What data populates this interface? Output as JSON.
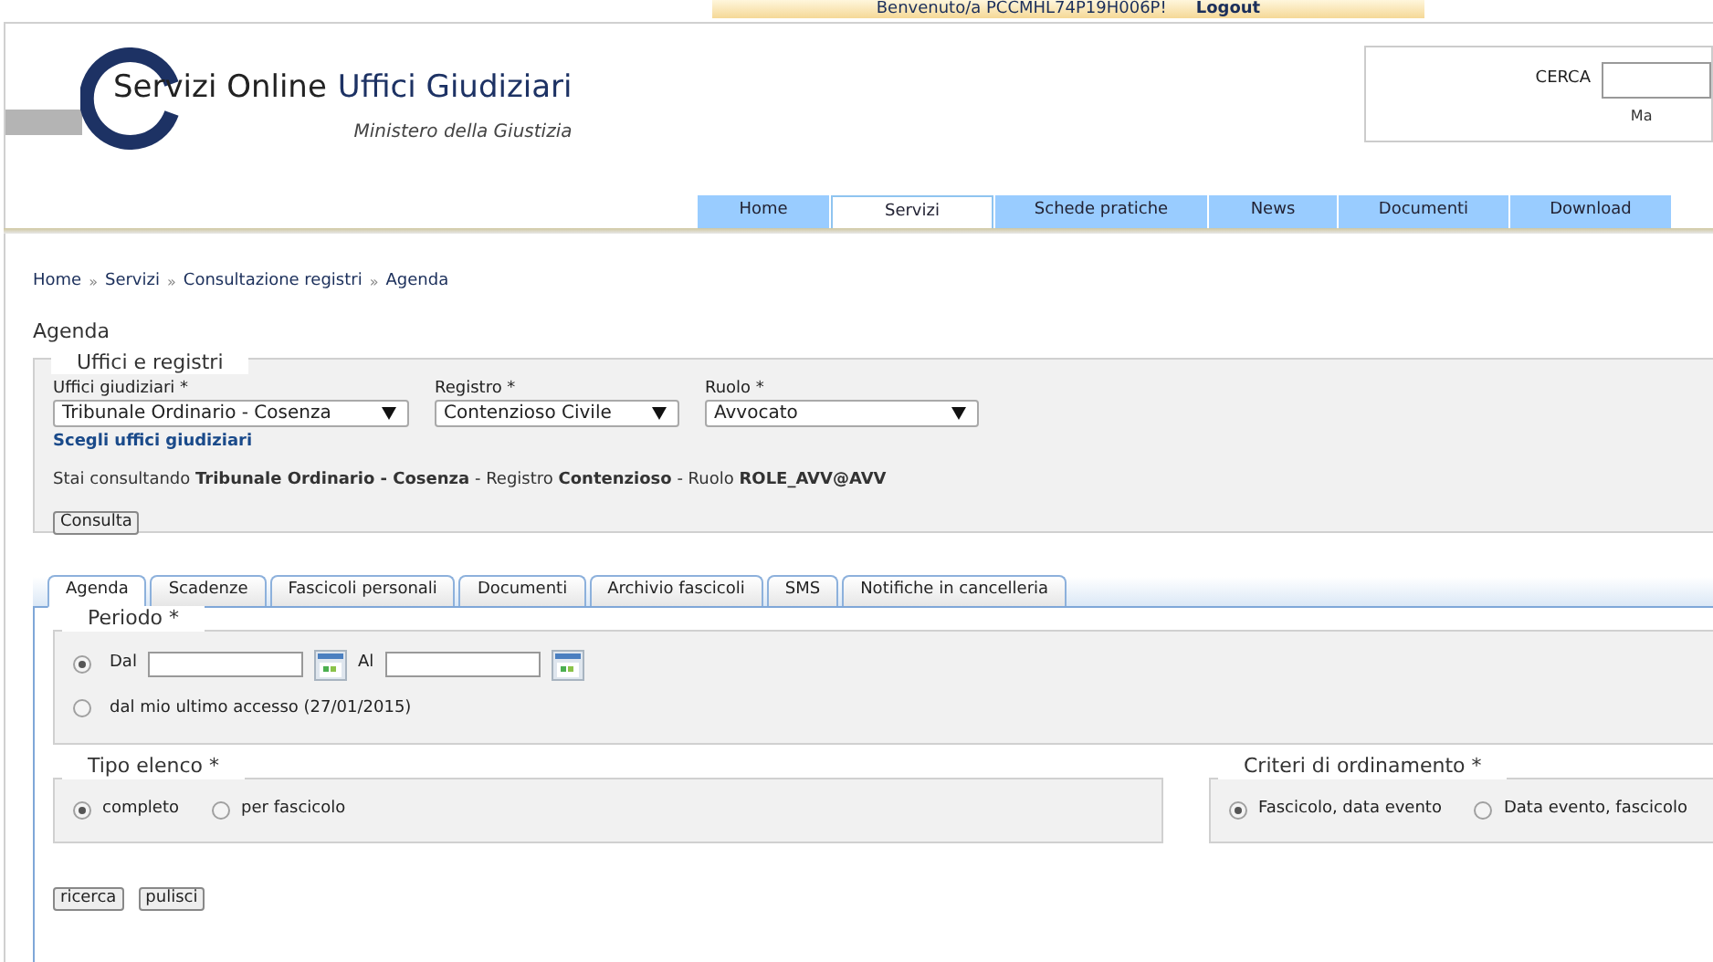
{
  "top_bar": {
    "welcome": "Benvenuto/a PCCMHL74P19H006P!",
    "logout": "Logout"
  },
  "logo": {
    "title_part1": "Servizi Online",
    "title_part2": "Uffici Giudiziari",
    "subtitle": "Ministero della Giustizia"
  },
  "search": {
    "label": "CERCA",
    "link": "Ma"
  },
  "nav_tabs": [
    {
      "label": "Home",
      "selected": false
    },
    {
      "label": "Servizi",
      "selected": true
    },
    {
      "label": "Schede pratiche",
      "selected": false
    },
    {
      "label": "News",
      "selected": false
    },
    {
      "label": "Documenti",
      "selected": false
    },
    {
      "label": "Download",
      "selected": false
    }
  ],
  "breadcrumb": [
    {
      "label": "Home"
    },
    {
      "separator": "»",
      "label": "Servizi"
    },
    {
      "separator": "»",
      "label": "Consultazione registri"
    },
    {
      "separator": "»",
      "label": "Agenda"
    }
  ],
  "page_title": "Agenda",
  "offices": {
    "legend": "Uffici e registri",
    "fields": [
      {
        "label": "Uffici giudiziari *",
        "value": "Tribunale Ordinario - Cosenza"
      },
      {
        "label": "Registro *",
        "value": "Contenzioso Civile"
      },
      {
        "label": "Ruolo *",
        "value": "Avvocato"
      }
    ],
    "link": "Scegli uffici giudiziari",
    "status": "Stai consultando **Tribunale Ordinario - Cosenza** - Registro **Contenzioso** - Ruolo **ROLE_AVV@AVV**",
    "button": "Consulta"
  },
  "tabs": [
    {
      "label": "Agenda",
      "selected": true
    },
    {
      "label": "Scadenze",
      "selected": false
    },
    {
      "label": "Fascicoli personali",
      "selected": false
    },
    {
      "label": "Documenti",
      "selected": false
    },
    {
      "label": "Archivio fascicoli",
      "selected": false
    },
    {
      "label": "SMS",
      "selected": false
    },
    {
      "label": "Notifiche in cancelleria",
      "selected": false
    }
  ],
  "periodo": {
    "legend": "Periodo *",
    "options": [
      {
        "kind": "range",
        "label": "Dal",
        "to_label": "Al",
        "selected": true
      },
      {
        "kind": "text",
        "label": "dal mio ultimo accesso (27/01/2015)",
        "selected": false
      }
    ]
  },
  "tipo_elenco": {
    "legend": "Tipo elenco *",
    "options": [
      {
        "label": "completo",
        "selected": true
      },
      {
        "label": "per fascicolo",
        "selected": false
      }
    ]
  },
  "criteri": {
    "legend": "Criteri di ordinamento *",
    "options": [
      {
        "label": "Fascicolo, data evento",
        "selected": true
      },
      {
        "label": "Data evento, fascicolo",
        "selected": false
      }
    ]
  },
  "buttons": [
    "ricerca",
    "pulisci"
  ]
}
